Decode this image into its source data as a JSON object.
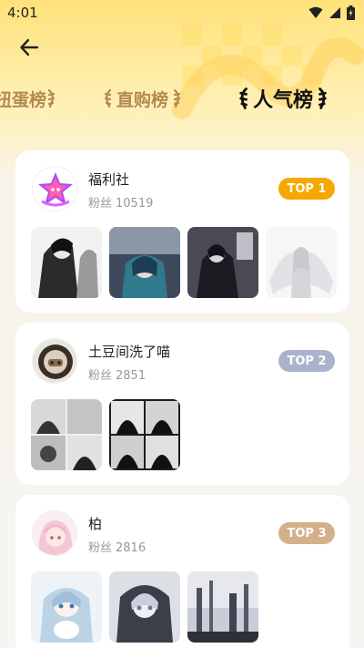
{
  "status_bar": {
    "time": "4:01"
  },
  "tabs": [
    {
      "label": "扭蛋榜"
    },
    {
      "label": "直购榜"
    },
    {
      "label": "人气榜"
    }
  ],
  "cards": [
    {
      "name": "福利社",
      "fans_label": "粉丝",
      "fans_count": "10519",
      "rank": "TOP 1",
      "rank_color": "#f5a800"
    },
    {
      "name": "土豆间洗了喵",
      "fans_label": "粉丝",
      "fans_count": "2851",
      "rank": "TOP 2",
      "rank_color": "#a9b4cc"
    },
    {
      "name": "柏",
      "fans_label": "粉丝",
      "fans_count": "2816",
      "rank": "TOP 3",
      "rank_color": "#d4b08a"
    }
  ],
  "colors": {
    "accent": "#ffd84a",
    "tab_inactive": "#b48a52"
  }
}
